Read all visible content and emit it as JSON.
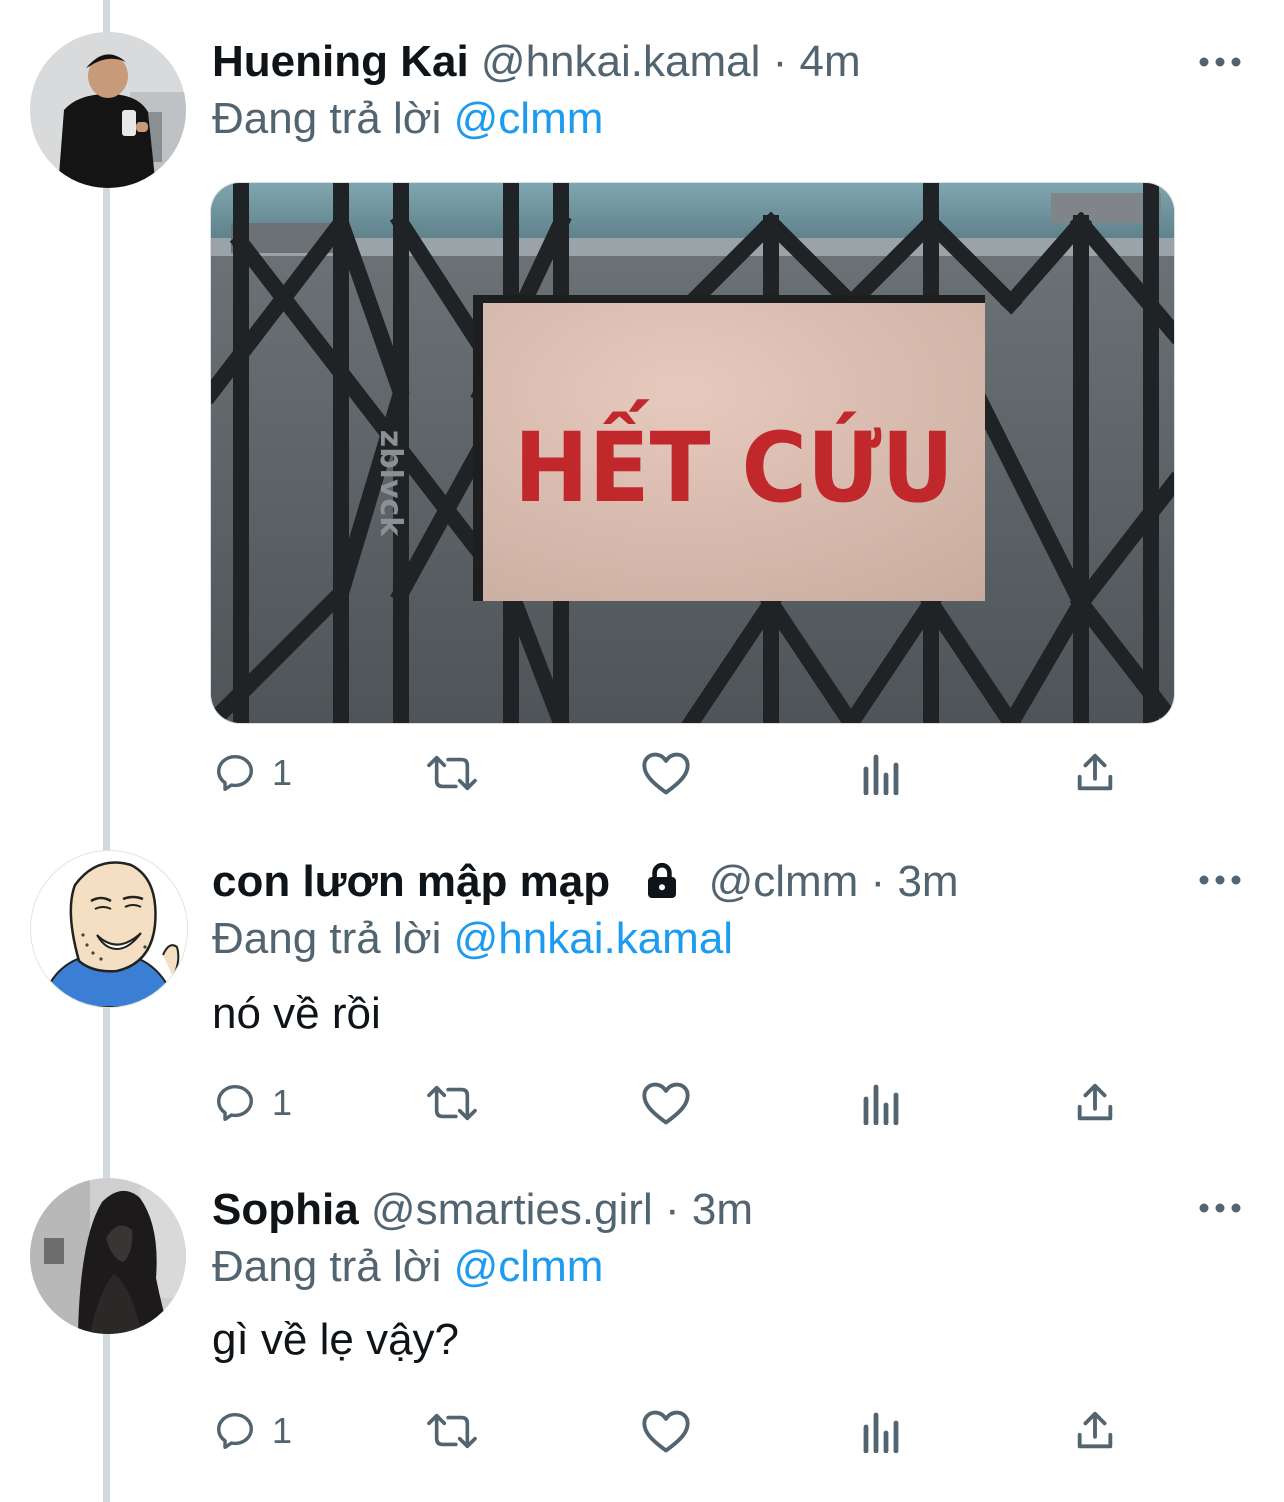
{
  "tweets": [
    {
      "name": "Huening Kai",
      "handle": "@hnkai.kamal",
      "separator": "·",
      "time": "4m",
      "replying_prefix": "Đang trả lời",
      "replying_to": "@clmm",
      "image_sign_text": "HẾT CỨU",
      "image_watermark": "zblvck",
      "reply_count": "1"
    },
    {
      "name": "con lươn mập mạp",
      "locked": true,
      "handle": "@clmm",
      "separator": "·",
      "time": "3m",
      "replying_prefix": "Đang trả lời",
      "replying_to": "@hnkai.kamal",
      "text": "nó về rồi",
      "reply_count": "1"
    },
    {
      "name": "Sophia",
      "handle": "@smarties.girl",
      "separator": "·",
      "time": "3m",
      "replying_prefix": "Đang trả lời",
      "replying_to": "@clmm",
      "text": "gì về lẹ vậy?",
      "reply_count": "1"
    }
  ],
  "icons": [
    "reply-icon",
    "retweet-icon",
    "like-icon",
    "views-icon",
    "share-icon",
    "more-icon",
    "lock-icon"
  ],
  "colors": {
    "link": "#1d9bf0",
    "secondary": "#536471",
    "sign_text": "#c0282c"
  }
}
